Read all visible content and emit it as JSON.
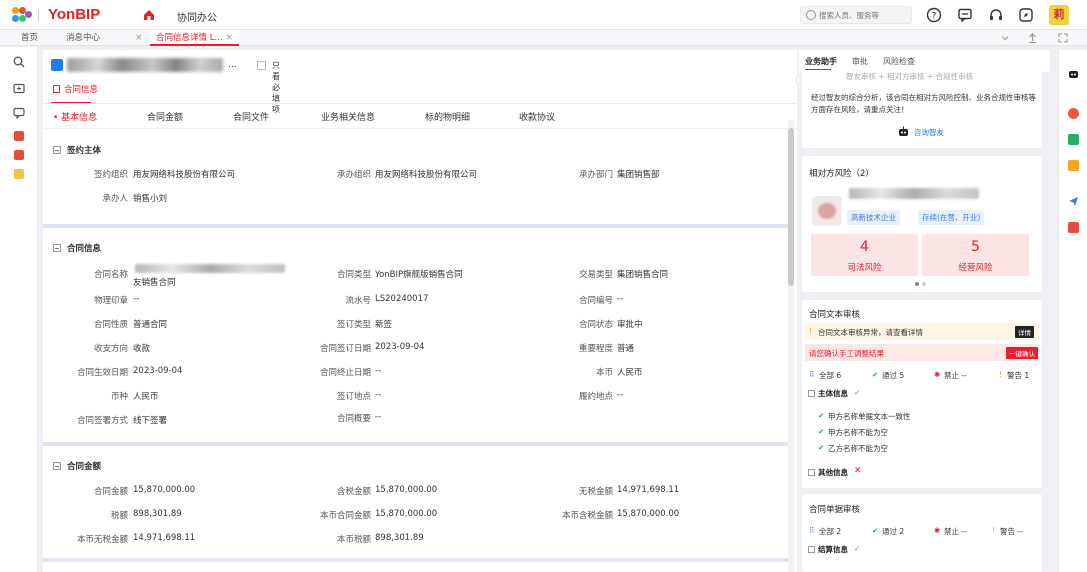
{
  "app": {
    "brand": "YonBIP",
    "menu_title": "协同办公",
    "avatar_text": "莉",
    "accent": "#e5202a"
  },
  "search": {
    "placeholder": "搜索人员、服务等"
  },
  "tabs": [
    {
      "label": "首页"
    },
    {
      "label": "消息中心",
      "close": "×"
    },
    {
      "label": "合同信息详情 L...",
      "close": "×"
    }
  ],
  "header": {
    "title_suffix": "...",
    "only_required_label": "只看必填项",
    "section_tab": "合同信息"
  },
  "subtabs": [
    "基本信息",
    "合同金额",
    "合同文件",
    "业务相关信息",
    "标的物明细",
    "收款协议"
  ],
  "sign_party": {
    "title": "签约主体",
    "fields": [
      {
        "label": "签约组织",
        "value": "用友网络科技股份有限公司"
      },
      {
        "label": "承办组织",
        "value": "用友网络科技股份有限公司"
      },
      {
        "label": "承办部门",
        "value": "集团销售部"
      },
      {
        "label": "承办人",
        "value": "销售小刘"
      }
    ]
  },
  "contract_info": {
    "title": "合同信息",
    "name_label": "合同名称",
    "name_value_tail": "友销售合同",
    "fields": {
      "contract_type": {
        "label": "合同类型",
        "value": "YonBIP旗舰版销售合同"
      },
      "trade_type": {
        "label": "交易类型",
        "value": "集团销售合同"
      },
      "physical_seal": {
        "label": "物理印章",
        "value": "--"
      },
      "serial_no": {
        "label": "流水号",
        "value": "LS20240017"
      },
      "contract_no": {
        "label": "合同编号",
        "value": "--"
      },
      "nature": {
        "label": "合同性质",
        "value": "普通合同"
      },
      "sign_type": {
        "label": "签订类型",
        "value": "新签"
      },
      "status": {
        "label": "合同状态",
        "value": "审批中"
      },
      "direction": {
        "label": "收支方向",
        "value": "收款"
      },
      "sign_date": {
        "label": "合同签订日期",
        "value": "2023-09-04"
      },
      "importance": {
        "label": "重要程度",
        "value": "普通"
      },
      "effective_date": {
        "label": "合同生效日期",
        "value": "2023-09-04"
      },
      "end_date": {
        "label": "合同终止日期",
        "value": "--"
      },
      "local_currency": {
        "label": "本币",
        "value": "人民币"
      },
      "currency": {
        "label": "币种",
        "value": "人民币"
      },
      "sign_place": {
        "label": "签订地点",
        "value": "--"
      },
      "perform_place": {
        "label": "履约地点",
        "value": "--"
      },
      "sign_method": {
        "label": "合同签署方式",
        "value": "线下签署"
      },
      "summary": {
        "label": "合同概要",
        "value": "--"
      }
    }
  },
  "amount": {
    "title": "合同金额",
    "fields": {
      "contract_amount": {
        "label": "合同金额",
        "value": "15,870,000.00"
      },
      "tax_incl": {
        "label": "含税金额",
        "value": "15,870,000.00"
      },
      "tax_excl": {
        "label": "无税金额",
        "value": "14,971,698.11"
      },
      "tax": {
        "label": "税额",
        "value": "898,301.89"
      },
      "local_contract_amount": {
        "label": "本币合同金额",
        "value": "15,870,000.00"
      },
      "local_tax_incl": {
        "label": "本币含税金额",
        "value": "15,870,000.00"
      },
      "local_tax_excl": {
        "label": "本币无税金额",
        "value": "14,971,698.11"
      },
      "local_tax": {
        "label": "本币税额",
        "value": "898,301.89"
      }
    }
  },
  "right": {
    "tabs": [
      "业务助手",
      "审批",
      "风险检查"
    ],
    "assistant": {
      "crumbs": "智友审核 + 相对方审核 + 合规性审核",
      "text": "经过智友的综合分析，该合同在相对方风险控制、业务合规性审核等方面存在风险，请重点关注！",
      "ask_label": "咨询智友"
    },
    "counterparty": {
      "title": "相对方风险（2）",
      "tag1": "高新技术企业",
      "tag2": "存续(在营、开业)",
      "judicial_count": "4",
      "judicial_label": "司法风险",
      "business_count": "5",
      "business_label": "经营风险"
    },
    "text_review": {
      "title": "合同文本审核",
      "alert": "合同文本审核异常，请查看详情",
      "detail_btn": "详情",
      "manual_text": "请您确认手工调整结果",
      "confirm_btn": "一键确认",
      "all": "全部 6",
      "pass": "通过 5",
      "forbid": "禁止 --",
      "warn": "警告 1",
      "group1": "主体信息",
      "items": [
        "甲方名称单据文本一致性",
        "甲方名称不能为空",
        "乙方名称不能为空"
      ],
      "group2": "其他信息"
    },
    "bill_review": {
      "title": "合同单据审核",
      "all": "全部 2",
      "pass": "通过 2",
      "forbid": "禁止 --",
      "warn": "警告 --",
      "group1": "结算信息"
    }
  }
}
